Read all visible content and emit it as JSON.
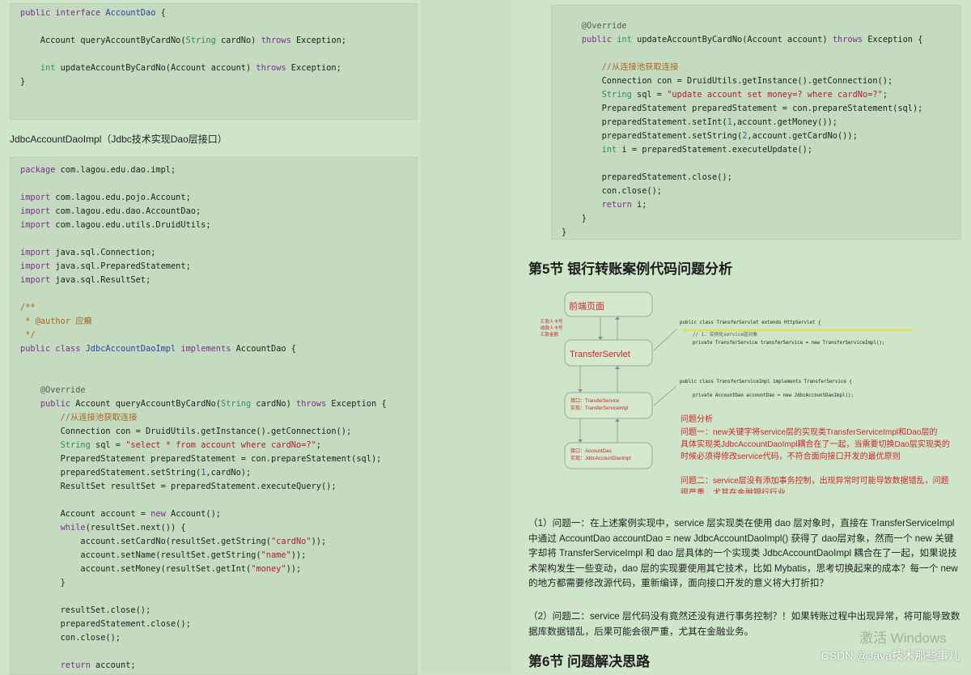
{
  "left": {
    "interface_code": [
      "public interface AccountDao {",
      "",
      "    Account queryAccountByCardNo(String cardNo) throws Exception;",
      "",
      "    int updateAccountByCardNo(Account account) throws Exception;",
      "}"
    ],
    "caption": "JdbcAccountDaoImpl（Jdbc技术实现Dao层接口）",
    "impl_code": [
      "package com.lagou.edu.dao.impl;",
      "",
      "import com.lagou.edu.pojo.Account;",
      "import com.lagou.edu.dao.AccountDao;",
      "import com.lagou.edu.utils.DruidUtils;",
      "",
      "import java.sql.Connection;",
      "import java.sql.PreparedStatement;",
      "import java.sql.ResultSet;",
      "",
      "/**",
      " * @author 应癫",
      " */",
      "public class JdbcAccountDaoImpl implements AccountDao {",
      "",
      "",
      "    @Override",
      "    public Account queryAccountByCardNo(String cardNo) throws Exception {",
      "        //从连接池获取连接",
      "        Connection con = DruidUtils.getInstance().getConnection();",
      "        String sql = \"select * from account where cardNo=?\";",
      "        PreparedStatement preparedStatement = con.prepareStatement(sql);",
      "        preparedStatement.setString(1,cardNo);",
      "        ResultSet resultSet = preparedStatement.executeQuery();",
      "",
      "        Account account = new Account();",
      "        while(resultSet.next()) {",
      "            account.setCardNo(resultSet.getString(\"cardNo\"));",
      "            account.setName(resultSet.getString(\"name\"));",
      "            account.setMoney(resultSet.getInt(\"money\"));",
      "        }",
      "",
      "        resultSet.close();",
      "        preparedStatement.close();",
      "        con.close();",
      "",
      "        return account;"
    ]
  },
  "right": {
    "update_code": [
      "    @Override",
      "    public int updateAccountByCardNo(Account account) throws Exception {",
      "",
      "        //从连接池获取连接",
      "        Connection con = DruidUtils.getInstance().getConnection();",
      "        String sql = \"update account set money=? where cardNo=?\";",
      "        PreparedStatement preparedStatement = con.prepareStatement(sql);",
      "        preparedStatement.setInt(1,account.getMoney());",
      "        preparedStatement.setString(2,account.getCardNo());",
      "        int i = preparedStatement.executeUpdate();",
      "",
      "        preparedStatement.close();",
      "        con.close();",
      "        return i;",
      "    }",
      "}"
    ],
    "section5_title": "第5节 银行转账案例代码问题分析",
    "diagram": {
      "box_frontend": "前端页面",
      "box_servlet": "TransferServlet",
      "box_service_line1": "接口：TransferService",
      "box_service_line2": "实现：TransferServiceImpl",
      "box_dao_line1": "接口：AccountDao",
      "box_dao_line2": "实现：JdbcAccountDaoImpl",
      "side_label1": "汇款人卡号",
      "side_label2": "收款人卡号",
      "side_label3": "汇款金额",
      "code_servlet": [
        "public class TransferServlet extends HttpServlet {",
        "",
        "    // 1. 实例化service层对象",
        "    private TransferService transferService = new TransferServiceImpl();"
      ],
      "code_service": [
        "public class TransferServiceImpl implements TransferService {",
        "",
        "    private AccountDao accountDao = new JdbcAccountDaoImpl();"
      ],
      "analysis_title": "问题分析",
      "analysis_q1": "问题一：new关键字将service层的实现类TransferServiceImpl和Dao层的具体实现类JdbcAccountDaoImpl耦合在了一起，当需要切换Dao层实现类的时候必须得修改service代码，不符合面向接口开发的最优原则",
      "analysis_q2": "问题二：service层没有添加事务控制，出现异常时可能导致数据错乱，问题很严重，尤其在金融银行行业"
    },
    "para1": "（1）问题一：在上述案例实现中，service 层实现类在使用 dao 层对象时，直接在 TransferServiceImpl 中通过 AccountDao accountDao = new JdbcAccountDaoImpl() 获得了 dao层对象，然而一个 new 关键字却将 TransferServiceImpl 和 dao 层具体的一个实现类 JdbcAccountDaoImpl 耦合在了一起，如果说技术架构发生一些变动，dao 层的实现要使用其它技术，比如 Mybatis，思考切换起来的成本？每一个 new 的地方都需要修改源代码，重新编译，面向接口开发的意义将大打折扣？",
    "para2": "（2）问题二：service 层代码没有竟然还没有进行事务控制？！如果转账过程中出现异常，将可能导致数据库数据错乱，后果可能会很严重，尤其在金融业务。",
    "section6_title": "第6节 问题解决思路",
    "watermark": "激活 Windows",
    "csdn_mark": "CSDN @Java技术那些事儿"
  }
}
